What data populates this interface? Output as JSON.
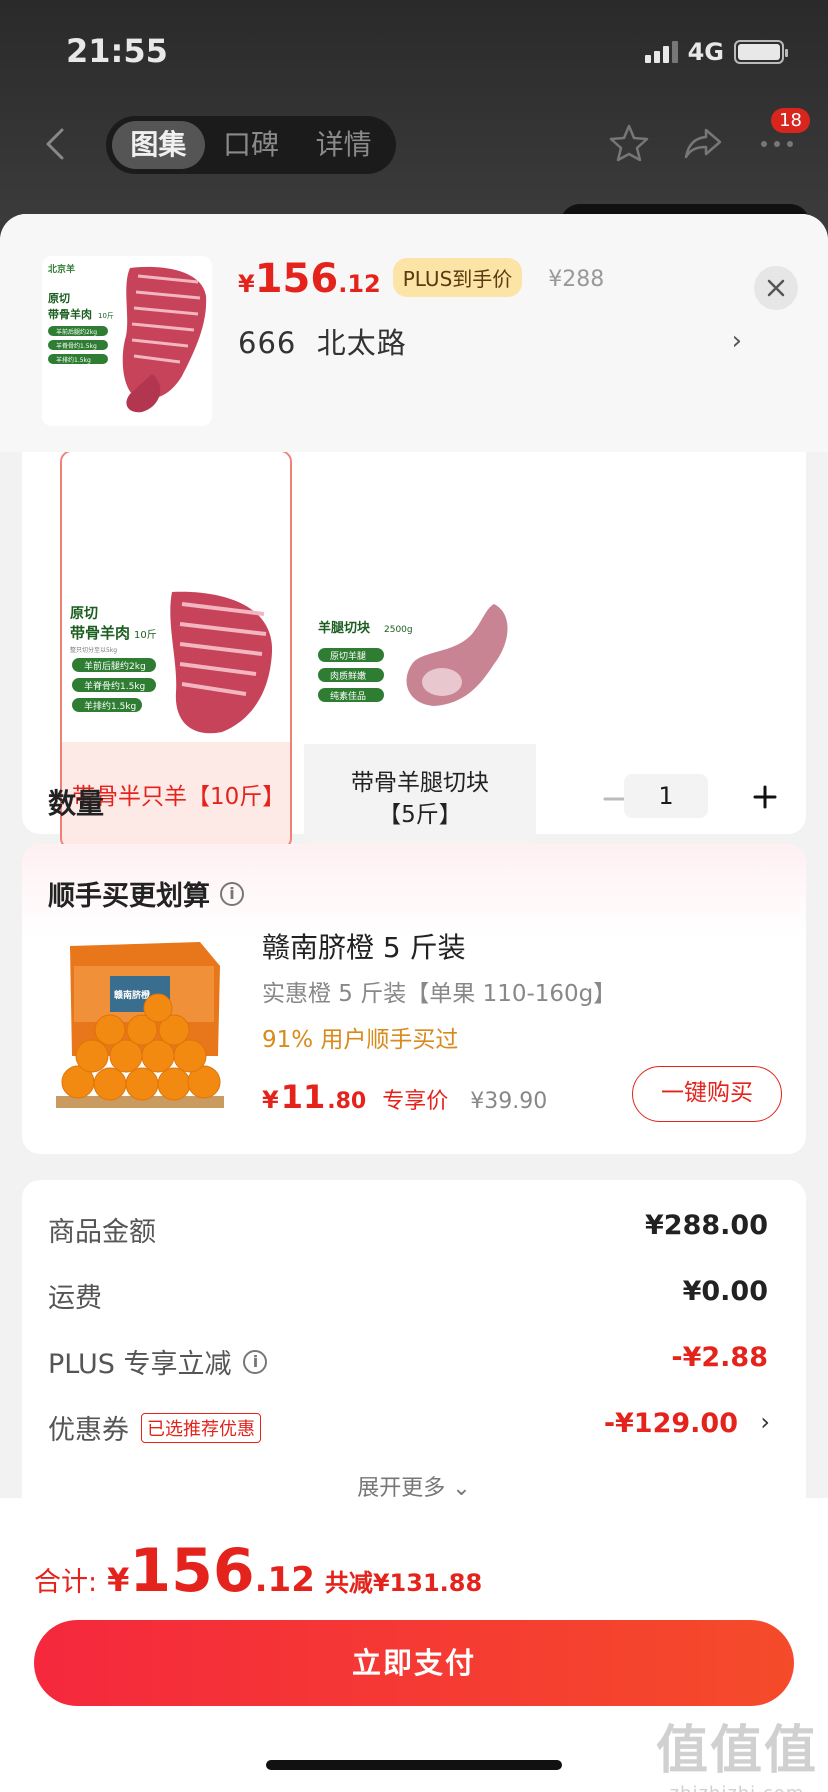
{
  "status": {
    "time": "21:55",
    "network": "4G"
  },
  "nav": {
    "tabs": [
      "图集",
      "口碑",
      "详情"
    ],
    "badge_count": "18"
  },
  "header": {
    "price_symbol": "¥",
    "price_int": "156",
    "price_dec": ".12",
    "plus_tag": "PLUS到手价",
    "original_price": "¥288",
    "address": "666  北太路",
    "arrow": "›"
  },
  "thumb": {
    "brand": "北京羊",
    "title_1": "原切",
    "title_2": "带骨羊肉",
    "weight": "10斤",
    "bullets": [
      "羊前后腿约2kg",
      "羊脊骨约1.5kg",
      "羊排约1.5kg"
    ]
  },
  "spec": {
    "options": [
      {
        "label": "带骨半只羊【10斤】",
        "img_title_1": "原切",
        "img_title_2": "带骨羊肉",
        "img_weight": "10斤",
        "img_note": "整只切分至以5kg",
        "img_bullets": [
          "羊前后腿约2kg",
          "羊脊骨约1.5kg",
          "羊排约1.5kg"
        ],
        "selected": true
      },
      {
        "label": "带骨羊腿切块\n【5斤】",
        "img_title_1": "羊腿切块",
        "img_weight": "2500g",
        "img_bullets": [
          "原切羊腿",
          "肉质鲜嫩",
          "纯素佳品"
        ],
        "selected": false
      }
    ],
    "qty_label": "数量",
    "qty_value": "1"
  },
  "promo": {
    "title": "顺手买更划算",
    "info": "i",
    "name": "赣南脐橙 5 斤装",
    "subtitle": "实惠橙 5 斤装【单果 110-160g】",
    "percent": "91% 用户顺手买过",
    "price_symbol": "¥",
    "price_int": "11",
    "price_dec": ".80",
    "price_tag": "专享价",
    "original": "¥39.90",
    "buy_label": "一键购买",
    "box_text": "赣南脐橙"
  },
  "summary": {
    "rows": [
      {
        "label": "商品金额",
        "value": "¥288.00"
      },
      {
        "label": "运费",
        "value": "¥0.00"
      },
      {
        "label": "PLUS 专享立减",
        "value": "-¥2.88"
      },
      {
        "label": "优惠券",
        "value": "-¥129.00",
        "tag": "已选推荐优惠"
      }
    ],
    "expand": "展开更多 ⌄"
  },
  "footer": {
    "total_label": "合计:",
    "symbol": "¥",
    "int": "156",
    "dec": ".12",
    "save": "共减¥131.88",
    "pay_label": "立即支付"
  },
  "watermark": {
    "big": "值值值",
    "small": "zhizhizhi.com"
  },
  "colors": {
    "accent": "#e4241c",
    "plus_tag_bg": "#fbe4a6",
    "promo_orange": "#d88a1c"
  }
}
